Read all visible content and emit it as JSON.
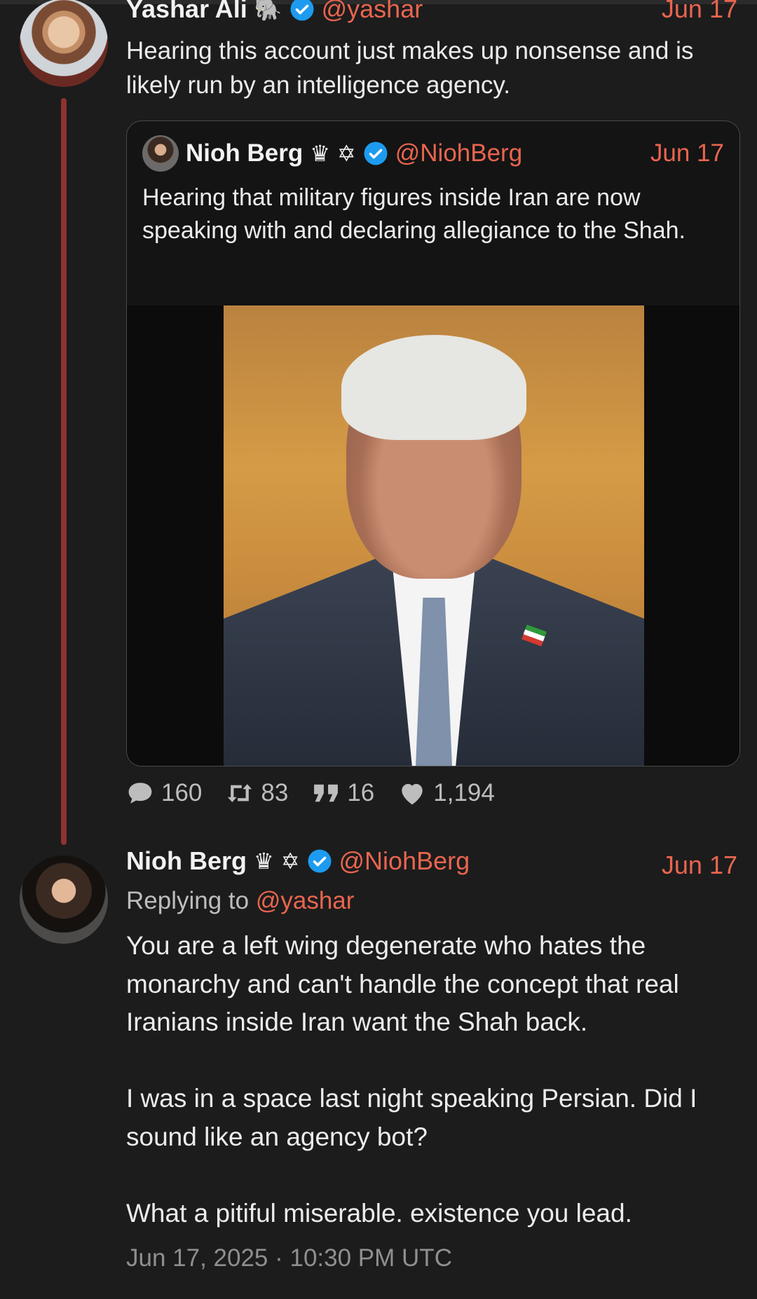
{
  "tweets": [
    {
      "author": "Yashar Ali",
      "handle": "@yashar",
      "date": "Jun 17",
      "text": "Hearing this account just makes up nonsense and is likely run by an intelligence agency.",
      "quoted": {
        "author": "Nioh Berg",
        "handle": "@NiohBerg",
        "date": "Jun 17",
        "text": "Hearing that military figures inside Iran are now speaking with and declaring allegiance to the Shah.",
        "badges": [
          "crown-icon",
          "star-of-david-icon",
          "verified-icon"
        ]
      },
      "stats": {
        "replies": "160",
        "retweets": "83",
        "quotes": "16",
        "likes": "1,194"
      }
    },
    {
      "author": "Nioh Berg",
      "handle": "@NiohBerg",
      "date": "Jun 17",
      "replying_to_label": "Replying to",
      "replying_to_handle": "@yashar",
      "text": "You are a left wing degenerate who hates the monarchy and can't handle the concept that real Iranians inside Iran want the Shah back.\n\nI was in a space last night speaking Persian. Did I sound like an agency bot?\n\nWhat a pitiful miserable. existence you lead.",
      "timestamp": "Jun 17, 2025 · 10:30 PM UTC"
    }
  ],
  "colors": {
    "accent": "#e9654f",
    "verified": "#1d9bf0",
    "thread_line": "#8f3230",
    "background": "#1c1c1c"
  }
}
